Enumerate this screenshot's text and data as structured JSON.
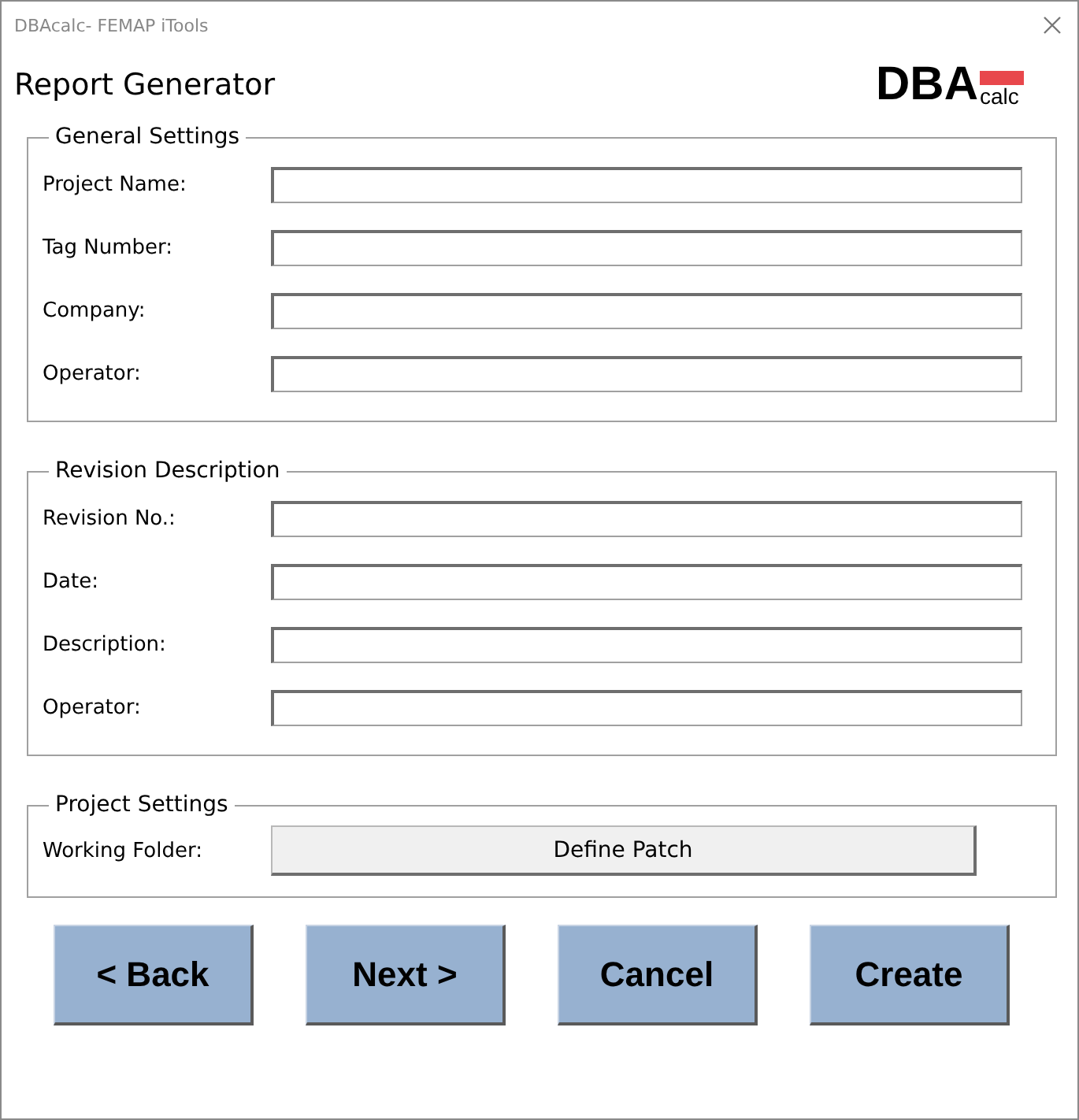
{
  "window": {
    "title": "DBAcalc- FEMAP iTools"
  },
  "heading": "Report Generator",
  "logo": {
    "main": "DBA",
    "sub": "calc"
  },
  "groups": [
    {
      "title": "General Settings",
      "fields": [
        {
          "kind": "text",
          "label": "Project Name:"
        },
        {
          "kind": "text",
          "label": "Tag Number:"
        },
        {
          "kind": "text",
          "label": "Company:"
        },
        {
          "kind": "text",
          "label": "Operator:"
        }
      ]
    },
    {
      "title": "Revision Description",
      "fields": [
        {
          "kind": "text",
          "label": "Revision No.:"
        },
        {
          "kind": "text",
          "label": "Date:"
        },
        {
          "kind": "text",
          "label": "Description:"
        },
        {
          "kind": "text",
          "label": "Operator:"
        }
      ]
    },
    {
      "title": "Project Settings",
      "fields": [
        {
          "kind": "button",
          "label": "Working Folder:",
          "button": "Define Patch"
        }
      ]
    }
  ],
  "buttons": [
    "< Back",
    "Next >",
    "Cancel",
    "Create"
  ]
}
